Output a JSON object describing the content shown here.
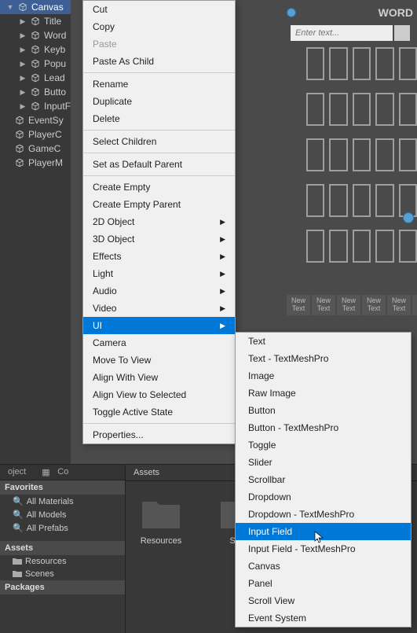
{
  "hierarchy": {
    "items": [
      {
        "label": "Canvas",
        "selected": true,
        "expandable": true
      },
      {
        "label": "Title",
        "expandable": true
      },
      {
        "label": "Word",
        "expandable": true
      },
      {
        "label": "Keyb",
        "expandable": true
      },
      {
        "label": "Popu",
        "expandable": true
      },
      {
        "label": "Lead",
        "expandable": true
      },
      {
        "label": "Butto",
        "expandable": true
      },
      {
        "label": "InputF",
        "expandable": true
      },
      {
        "label": "EventSy"
      },
      {
        "label": "PlayerC"
      },
      {
        "label": "GameC"
      },
      {
        "label": "PlayerM"
      }
    ]
  },
  "scene": {
    "title": "WORD",
    "input_placeholder": "Enter text...",
    "new_text_label_top": "New",
    "new_text_label_bot": "Text"
  },
  "context_menu": {
    "items": [
      {
        "label": "Cut"
      },
      {
        "label": "Copy"
      },
      {
        "label": "Paste",
        "disabled": true
      },
      {
        "label": "Paste As Child"
      },
      {
        "sep": true
      },
      {
        "label": "Rename"
      },
      {
        "label": "Duplicate"
      },
      {
        "label": "Delete"
      },
      {
        "sep": true
      },
      {
        "label": "Select Children"
      },
      {
        "sep": true
      },
      {
        "label": "Set as Default Parent"
      },
      {
        "sep": true
      },
      {
        "label": "Create Empty"
      },
      {
        "label": "Create Empty Parent"
      },
      {
        "label": "2D Object",
        "submenu": true
      },
      {
        "label": "3D Object",
        "submenu": true
      },
      {
        "label": "Effects",
        "submenu": true
      },
      {
        "label": "Light",
        "submenu": true
      },
      {
        "label": "Audio",
        "submenu": true
      },
      {
        "label": "Video",
        "submenu": true
      },
      {
        "label": "UI",
        "submenu": true,
        "highlighted": true
      },
      {
        "label": "Camera"
      },
      {
        "label": "Move To View"
      },
      {
        "label": "Align With View"
      },
      {
        "label": "Align View to Selected"
      },
      {
        "label": "Toggle Active State"
      },
      {
        "sep": true
      },
      {
        "label": "Properties..."
      }
    ]
  },
  "submenu": {
    "items": [
      {
        "label": "Text"
      },
      {
        "label": "Text - TextMeshPro"
      },
      {
        "label": "Image"
      },
      {
        "label": "Raw Image"
      },
      {
        "label": "Button"
      },
      {
        "label": "Button - TextMeshPro"
      },
      {
        "label": "Toggle"
      },
      {
        "label": "Slider"
      },
      {
        "label": "Scrollbar"
      },
      {
        "label": "Dropdown"
      },
      {
        "label": "Dropdown - TextMeshPro"
      },
      {
        "label": "Input Field",
        "highlighted": true
      },
      {
        "label": "Input Field - TextMeshPro"
      },
      {
        "label": "Canvas"
      },
      {
        "label": "Panel"
      },
      {
        "label": "Scroll View"
      },
      {
        "label": "Event System"
      }
    ]
  },
  "project": {
    "tab1": "oject",
    "tab2": "Co",
    "favorites_header": "Favorites",
    "favorites": [
      "All Materials",
      "All Models",
      "All Prefabs"
    ],
    "assets_header": "Assets",
    "asset_folders": [
      "Resources",
      "Scenes"
    ],
    "packages_header": "Packages",
    "breadcrumb": "Assets",
    "grid_items": [
      "Resources",
      "Scen"
    ]
  }
}
